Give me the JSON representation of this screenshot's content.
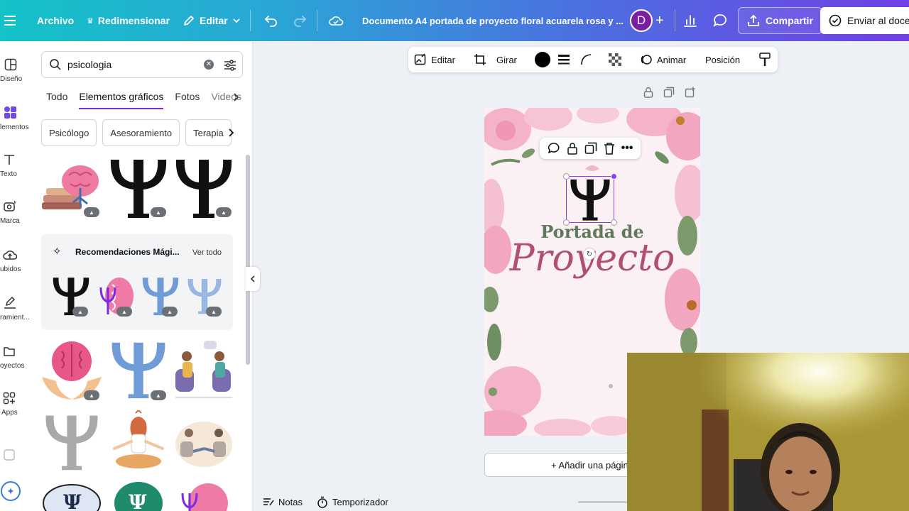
{
  "topbar": {
    "file_label": "Archivo",
    "resize_label": "Redimensionar",
    "edit_label": "Editar",
    "document_title": "Documento A4 portada de proyecto floral acuarela rosa y ...",
    "avatar_letter": "D",
    "share_label": "Compartir",
    "send_label": "Enviar al docen"
  },
  "rail": {
    "items": [
      {
        "label": "Diseño",
        "icon": "layout-icon"
      },
      {
        "label": "lementos",
        "icon": "elements-icon"
      },
      {
        "label": "Texto",
        "icon": "text-icon"
      },
      {
        "label": "Marca",
        "icon": "brand-icon"
      },
      {
        "label": "ubidos",
        "icon": "upload-icon"
      },
      {
        "label": "ramient...",
        "icon": "draw-icon"
      },
      {
        "label": "oyectos",
        "icon": "folder-icon"
      },
      {
        "label": "Apps",
        "icon": "apps-icon"
      }
    ]
  },
  "panel": {
    "search_value": "psicologia",
    "tabs": [
      "Todo",
      "Elementos gráficos",
      "Fotos",
      "Videos"
    ],
    "active_tab": "Elementos gráficos",
    "chips": [
      "Psicólogo",
      "Asesoramiento",
      "Terapia"
    ],
    "reco_title": "Recomendaciones Mági...",
    "reco_link": "Ver todo"
  },
  "context_toolbar": {
    "edit_label": "Editar",
    "rotate_label": "Girar",
    "animate_label": "Animar",
    "position_label": "Posición"
  },
  "page": {
    "line1": "Portada de",
    "line2": "Proyecto"
  },
  "add_page_label": "+ Añadir una página",
  "bottombar": {
    "notes_label": "Notas",
    "timer_label": "Temporizador"
  },
  "colors": {
    "accent": "#7d2ae8",
    "title_green": "#5f7a5a",
    "title_pink": "#b0506e",
    "psi_blue": "#6f9bd6",
    "avatar": "#7a1fa2"
  }
}
